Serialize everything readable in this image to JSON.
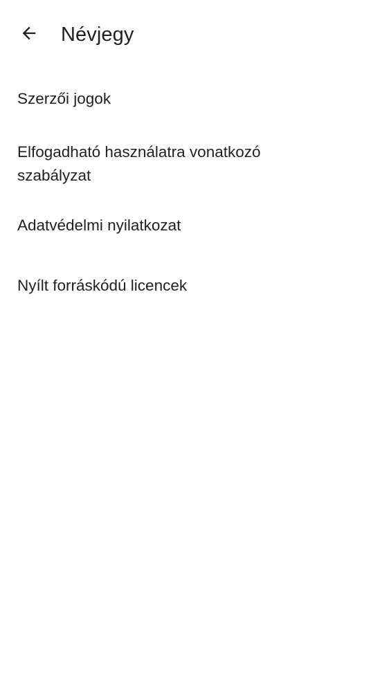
{
  "header": {
    "title": "Névjegy",
    "back_icon": "arrow-back-icon"
  },
  "menu": {
    "items": [
      {
        "label": "Szerzői jogok"
      },
      {
        "label": "Elfogadható használatra vonatkozó szabályzat"
      },
      {
        "label": "Adatvédelmi nyilatkozat"
      },
      {
        "label": "Nyílt forráskódú licencek"
      }
    ]
  },
  "colors": {
    "background": "#ffffff",
    "text": "#1f1f1f"
  }
}
